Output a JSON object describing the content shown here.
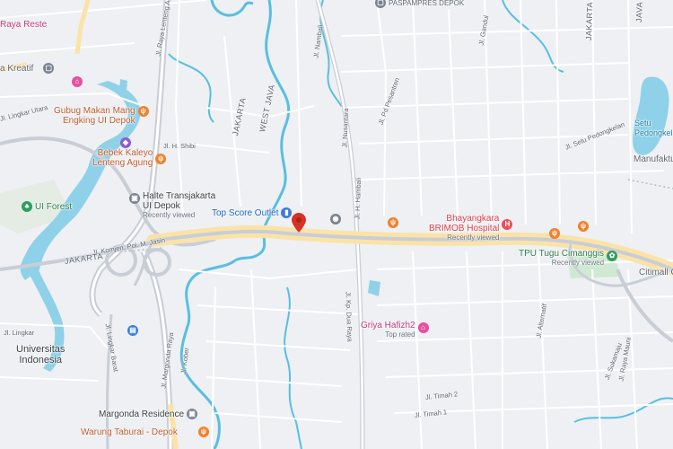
{
  "map": {
    "colors": {
      "background": "#eef0f3",
      "road": "#ffffff",
      "highway": "#c9ced6",
      "major_road": "#fbe3a8",
      "water": "#8fd1e8",
      "river": "#58bfe0",
      "park": "#cfe9d2",
      "marker": "#d93025"
    },
    "regions": [
      {
        "name": "JAKARTA",
        "name_top": "JAKARTA",
        "name_right": "JAKARTA"
      },
      {
        "name": "WEST JAVA",
        "name_top": "WEST JAVA",
        "name_right": "JAVA"
      }
    ],
    "places": [
      {
        "id": "raya-reste",
        "name": "Raya Reste",
        "icon": "lodging-icon"
      },
      {
        "id": "kreatif",
        "name": "a Kreatif",
        "icon": "shop-icon"
      },
      {
        "id": "gubug",
        "name": "Gubug Makan Mang Engking UI Depok",
        "line1": "Gubug Makan Mang",
        "line2": "Engking UI Depok",
        "icon": "restaurant-icon"
      },
      {
        "id": "bebek",
        "name": "Bebek Kaleyo Lenteng Agung",
        "line1": "Bebek Kaleyo",
        "line2": "Lenteng Agung",
        "icon": "restaurant-icon"
      },
      {
        "id": "ui-forest",
        "name": "UI Forest",
        "icon": "park-icon"
      },
      {
        "id": "halte",
        "name": "Halte Transjakarta UI Depok",
        "line1": "Halte Transjakarta",
        "line2": "UI Depok",
        "sub": "Recently viewed",
        "icon": "bus-stop-icon"
      },
      {
        "id": "top-score",
        "name": "Top Score Outlet",
        "icon": "shopping-bag-icon"
      },
      {
        "id": "bhayangkara",
        "name": "Bhayangkara BRIMOB Hospital",
        "line1": "Bhayangkara",
        "line2": "BRIMOB Hospital",
        "sub": "Recently viewed",
        "icon": "hospital-icon"
      },
      {
        "id": "tpu",
        "name": "TPU Tugu Cimanggis",
        "sub": "Recently viewed",
        "icon": "cemetery-icon"
      },
      {
        "id": "setu",
        "name": "Setu Pedongkelan",
        "line1": "Setu",
        "line2": "Pedongkelan",
        "icon": "lake-icon"
      },
      {
        "id": "manufaktur",
        "name": "Manufaktur",
        "icon": "building-icon"
      },
      {
        "id": "citimall",
        "name": "Citimall Cim",
        "icon": "shopping-icon"
      },
      {
        "id": "univ",
        "name": "Universitas Indonesia",
        "line1": "Universitas",
        "line2": "Indonesia",
        "icon": "university-icon"
      },
      {
        "id": "griya",
        "name": "Griya Hafizh2",
        "sub": "Top rated",
        "icon": "lodging-icon"
      },
      {
        "id": "margonda",
        "name": "Margonda Residence",
        "icon": "apartment-icon"
      },
      {
        "id": "warung",
        "name": "Warung Taburai - Depok",
        "icon": "restaurant-icon"
      },
      {
        "id": "paspampres",
        "name": "PASPAMPRES DEPOK",
        "icon": "building-icon"
      }
    ],
    "streets": [
      "Jl. Raya Lenteng Agung",
      "Jl. H. Shibi",
      "Jl. Komjen. Pol. M. Jasin",
      "Jl. Margonda Raya",
      "Jl. Kober",
      "Jl. Nusantara",
      "Jl. H. Hambali",
      "Jl. Kp. Dua Raya",
      "Jl. Timah 2",
      "Jl. Timah 1",
      "Jl. Lingkar",
      "Jl. Alternatif",
      "Jl. Setu Pedongkelan",
      "Jl. Gandul",
      "Jl. Nambali",
      "Jl. Sukamaju",
      "Jl. Raya Mauni",
      "Jl. Pd Pesantren",
      "Jl. Lingkar Barat",
      "Jl. Lingkar Utara"
    ],
    "land_labels": {
      "jakarta_left": "JAKARTA",
      "jakarta_top": "JAKARTA",
      "west_java": "WEST JAVA",
      "top_right": "JAKARTA"
    }
  }
}
